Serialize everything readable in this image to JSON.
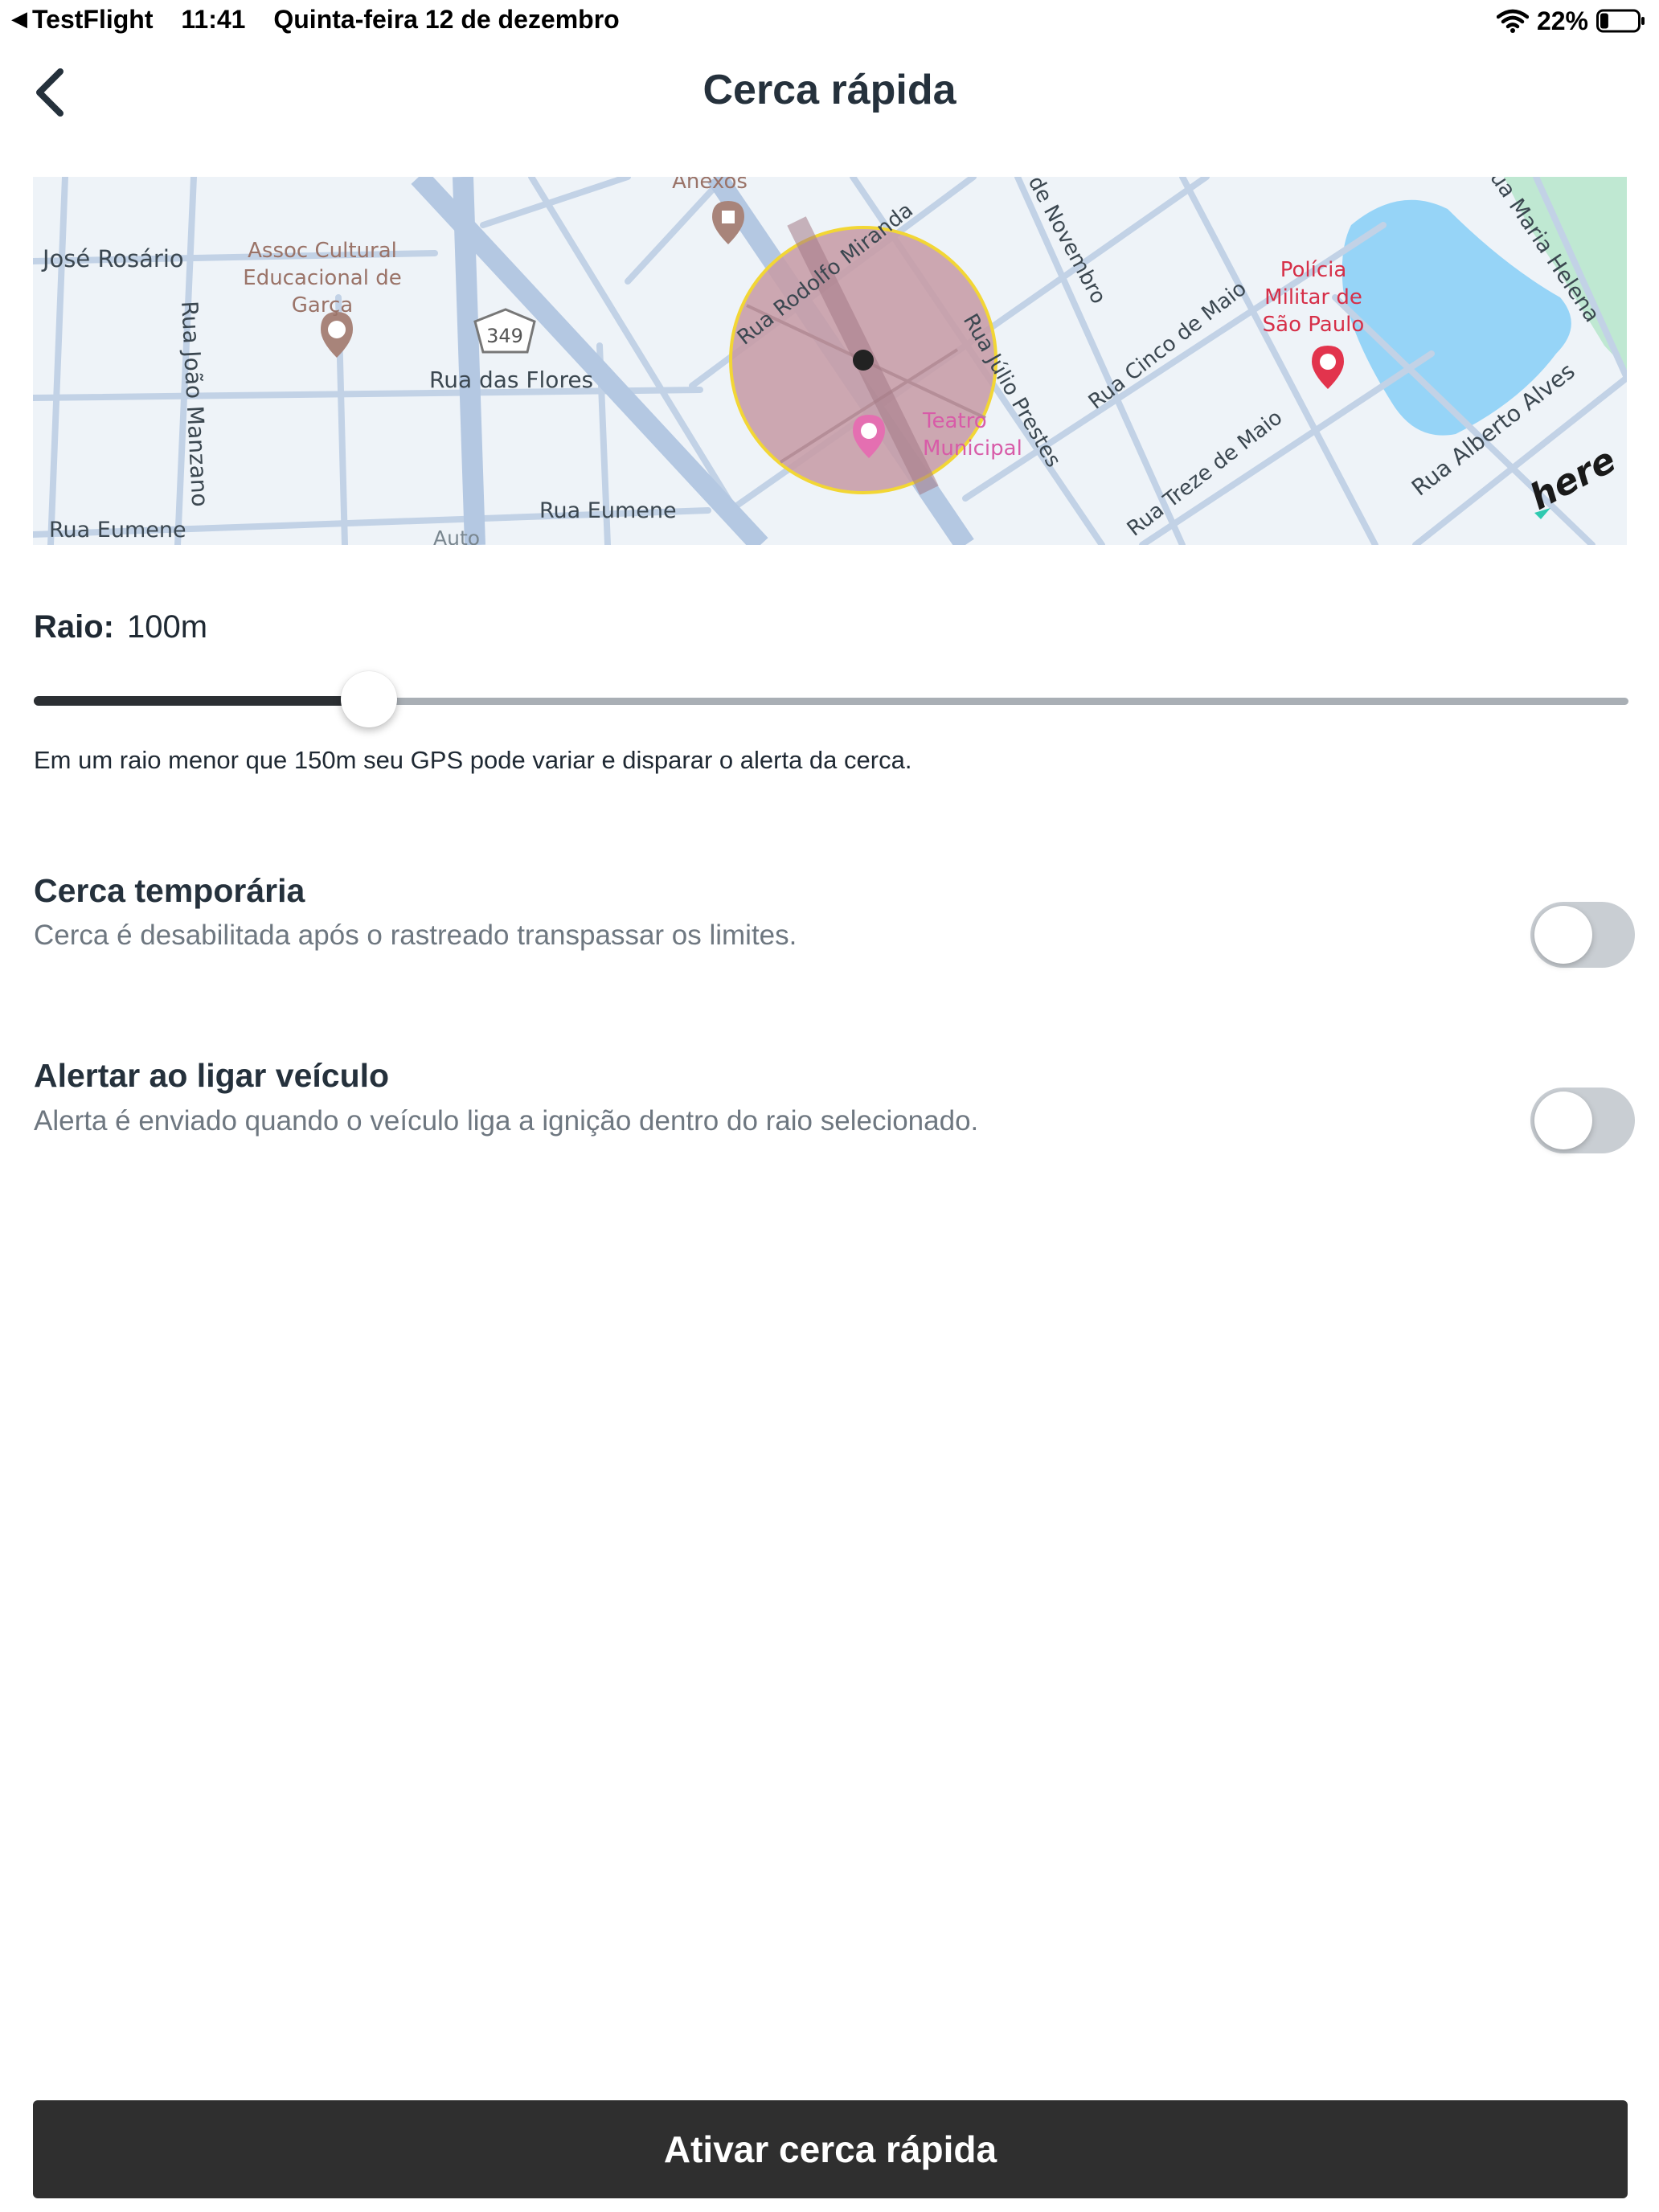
{
  "status_bar": {
    "app": "TestFlight",
    "time": "11:41",
    "date": "Quinta-feira 12 de dezembro",
    "battery": "22%",
    "battery_level": 0.22
  },
  "header": {
    "title": "Cerca rápida"
  },
  "map": {
    "fence_fill": "#c79ca6",
    "fence_stroke": "#f2d635",
    "labels": {
      "jose_rosario": "José Rosário",
      "assoc_1": "Assoc Cultural",
      "assoc_2": "Educacional de",
      "assoc_3": "Garça",
      "route": "349",
      "rua_flores": "Rua das Flores",
      "rua_joao_manzano": "Rua João Manzano",
      "rua_eumene_1": "Rua Eumene",
      "rua_eumene_2": "Rua Eumene",
      "auto": "Auto",
      "anexos": "Anexos",
      "rua_rodolfo": "Rua Rodolfo Miranda",
      "de_novembro": "de Novembro",
      "rua_julio": "Rua Júlio Prestes",
      "rua_cinco": "Rua Cinco de Maio",
      "rua_treze": "Rua Treze de Maio",
      "teatro_1": "Teatro",
      "teatro_2": "Municipal",
      "policia_1": "Polícia",
      "policia_2": "Militar de",
      "policia_3": "São Paulo",
      "rua_alberto": "Rua Alberto Alves",
      "rua_maria": "ua Maria Helena",
      "here_logo": "here"
    }
  },
  "radius": {
    "label": "Raio:",
    "value": "100m",
    "slider_fraction": 0.21
  },
  "hint": "Em um raio menor que 150m seu GPS pode variar e disparar o alerta da cerca.",
  "settings": [
    {
      "title": "Cerca temporária",
      "description": "Cerca é desabilitada após o rastreado transpassar os limites.",
      "enabled": false
    },
    {
      "title": "Alertar ao ligar veículo",
      "description": "Alerta é enviado quando o veículo liga a ignição dentro do raio selecionado.",
      "enabled": false
    }
  ],
  "cta": {
    "label": "Ativar cerca rápida"
  }
}
